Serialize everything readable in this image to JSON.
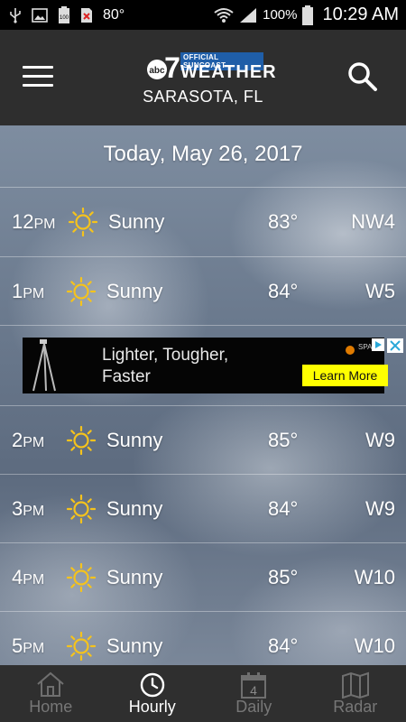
{
  "status_bar": {
    "temperature": "80°",
    "battery_level_icon_text": "100",
    "battery_percent": "100%",
    "time": "10:29 AM"
  },
  "header": {
    "logo_tagline": "OFFICIAL SUNCOAST",
    "logo_channel": "abc",
    "logo_number": "7",
    "logo_title": "WEATHER",
    "location": "SARASOTA, FL"
  },
  "date_title": "Today, May 26, 2017",
  "hourly": [
    {
      "hour": "12",
      "ampm": "PM",
      "condition": "Sunny",
      "temp": "83°",
      "wind": "NW4"
    },
    {
      "hour": "1",
      "ampm": "PM",
      "condition": "Sunny",
      "temp": "84°",
      "wind": "W5"
    },
    {
      "hour": "2",
      "ampm": "PM",
      "condition": "Sunny",
      "temp": "85°",
      "wind": "W9"
    },
    {
      "hour": "3",
      "ampm": "PM",
      "condition": "Sunny",
      "temp": "84°",
      "wind": "W9"
    },
    {
      "hour": "4",
      "ampm": "PM",
      "condition": "Sunny",
      "temp": "85°",
      "wind": "W10"
    },
    {
      "hour": "5",
      "ampm": "PM",
      "condition": "Sunny",
      "temp": "84°",
      "wind": "W10"
    }
  ],
  "ad": {
    "line1": "Lighter, Tougher,",
    "line2": "Faster",
    "cta": "Learn More",
    "brand": "SPA"
  },
  "bottom_nav": [
    {
      "label": "Home",
      "icon": "home-icon"
    },
    {
      "label": "Hourly",
      "icon": "clock-icon"
    },
    {
      "label": "Daily",
      "icon": "calendar-icon",
      "badge": "4"
    },
    {
      "label": "Radar",
      "icon": "map-icon"
    }
  ],
  "colors": {
    "header_bg": "#2e2e2e",
    "sun_icon": "#f5c31c",
    "ad_cta_bg": "#ffff00",
    "nav_active": "#ffffff",
    "nav_inactive": "#777777"
  }
}
